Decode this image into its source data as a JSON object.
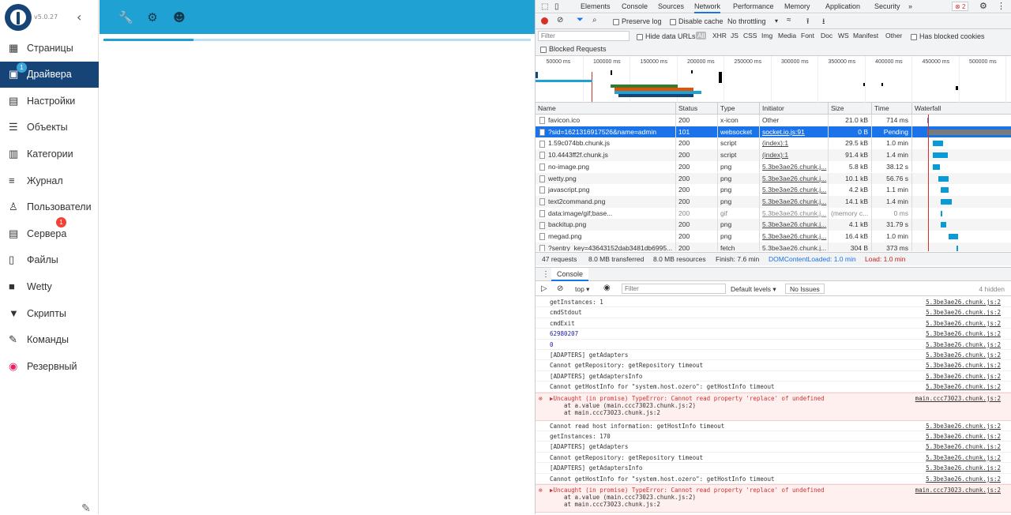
{
  "app": {
    "version": "v5.0.27",
    "collapse_icon": "chevron-left-icon",
    "sidebar": [
      {
        "label": "Страницы",
        "icon": "grid-icon",
        "active": false
      },
      {
        "label": "Драйвера",
        "icon": "driver-icon",
        "active": true,
        "badge": "1"
      },
      {
        "label": "Настройки",
        "icon": "settings-icon",
        "active": false
      },
      {
        "label": "Объекты",
        "icon": "list-icon",
        "active": false
      },
      {
        "label": "Категории",
        "icon": "category-icon",
        "active": false
      },
      {
        "label": "Журнал",
        "icon": "log-icon",
        "active": false
      },
      {
        "label": "Пользователи",
        "icon": "user-icon",
        "active": false
      },
      {
        "label": "Сервера",
        "icon": "server-icon",
        "active": false,
        "badge": "1"
      },
      {
        "label": "Файлы",
        "icon": "files-icon",
        "active": false
      },
      {
        "label": "Wetty",
        "icon": "terminal-icon",
        "active": false
      },
      {
        "label": "Скрипты",
        "icon": "script-icon",
        "active": false
      },
      {
        "label": "Команды",
        "icon": "commands-icon",
        "active": false
      },
      {
        "label": "Резервный",
        "icon": "backup-icon",
        "active": false
      }
    ],
    "topbar_icons": [
      "wrench-icon",
      "bug-icon",
      "head-icon"
    ],
    "accent": "#1fa2d3",
    "sidebar_active": "#164477",
    "progress": 0.21
  },
  "devtools": {
    "tabs": [
      "Elements",
      "Console",
      "Sources",
      "Network",
      "Performance",
      "Memory",
      "Application",
      "Security",
      "»"
    ],
    "active_tab": "Network",
    "error_count": "2",
    "toolbar": {
      "preserve_log": "Preserve log",
      "disable_cache": "Disable cache",
      "throttling": "No throttling"
    },
    "filter": {
      "placeholder": "Filter",
      "hide_data_urls": "Hide data URLs",
      "types": [
        "All",
        "XHR",
        "JS",
        "CSS",
        "Img",
        "Media",
        "Font",
        "Doc",
        "WS",
        "Manifest",
        "Other"
      ],
      "has_blocked": "Has blocked cookies",
      "blocked_requests": "Blocked Requests"
    },
    "overview_ticks": [
      "50000 ms",
      "100000 ms",
      "150000 ms",
      "200000 ms",
      "250000 ms",
      "300000 ms",
      "350000 ms",
      "400000 ms",
      "450000 ms",
      "500000 ms"
    ],
    "columns": [
      "Name",
      "Status",
      "Type",
      "Initiator",
      "Size",
      "Time",
      "Waterfall"
    ],
    "rows": [
      {
        "name": "favicon.ico",
        "status": "200",
        "type": "x-icon",
        "initiator": "Other",
        "size": "21.0 kB",
        "time": "714 ms",
        "wf": 0.03,
        "ww": 0.02,
        "link": false
      },
      {
        "name": "?sid=1621316917526&name=admin",
        "status": "101",
        "type": "websocket",
        "initiator": "socket.io.js:91",
        "size": "0 B",
        "time": "Pending",
        "wf": 0.03,
        "ww": 0.97,
        "link": true,
        "sel": true
      },
      {
        "name": "1.59c074bb.chunk.js",
        "status": "200",
        "type": "script",
        "initiator": "(index):1",
        "size": "29.5 kB",
        "time": "1.0 min",
        "wf": 0.1,
        "ww": 0.13,
        "link": true
      },
      {
        "name": "10.4443ff2f.chunk.js",
        "status": "200",
        "type": "script",
        "initiator": "(index):1",
        "size": "91.4 kB",
        "time": "1.4 min",
        "wf": 0.1,
        "ww": 0.19,
        "link": true
      },
      {
        "name": "no-image.png",
        "status": "200",
        "type": "png",
        "initiator": "5.3be3ae26.chunk.j...",
        "size": "5.8 kB",
        "time": "38.12 s",
        "wf": 0.1,
        "ww": 0.09,
        "link": true
      },
      {
        "name": "wetty.png",
        "status": "200",
        "type": "png",
        "initiator": "5.3be3ae26.chunk.j...",
        "size": "10.1 kB",
        "time": "56.76 s",
        "wf": 0.17,
        "ww": 0.13,
        "link": true
      },
      {
        "name": "javascript.png",
        "status": "200",
        "type": "png",
        "initiator": "5.3be3ae26.chunk.j...",
        "size": "4.2 kB",
        "time": "1.1 min",
        "wf": 0.2,
        "ww": 0.1,
        "link": true
      },
      {
        "name": "text2command.png",
        "status": "200",
        "type": "png",
        "initiator": "5.3be3ae26.chunk.j...",
        "size": "14.1 kB",
        "time": "1.4 min",
        "wf": 0.2,
        "ww": 0.14,
        "link": true
      },
      {
        "name": "data:image/gif;base...",
        "status": "200",
        "type": "gif",
        "initiator": "5.3be3ae26.chunk.j...",
        "size": "(memory c...",
        "time": "0 ms",
        "wf": 0.2,
        "ww": 0.01,
        "link": true,
        "dim": true
      },
      {
        "name": "backitup.png",
        "status": "200",
        "type": "png",
        "initiator": "5.3be3ae26.chunk.j...",
        "size": "4.1 kB",
        "time": "31.79 s",
        "wf": 0.2,
        "ww": 0.07,
        "link": true
      },
      {
        "name": "megad.png",
        "status": "200",
        "type": "png",
        "initiator": "5.3be3ae26.chunk.j...",
        "size": "16.4 kB",
        "time": "1.0 min",
        "wf": 0.3,
        "ww": 0.12,
        "link": true
      },
      {
        "name": "?sentry_key=43643152dab3481db6995...",
        "status": "200",
        "type": "fetch",
        "initiator": "5.3be3ae26.chunk.j...",
        "size": "304 B",
        "time": "373 ms",
        "wf": 0.4,
        "ww": 0.02,
        "link": true
      }
    ],
    "summary": {
      "requests": "47 requests",
      "transferred": "8.0 MB transferred",
      "resources": "8.0 MB resources",
      "finish": "Finish: 7.6 min",
      "dcl": "DOMContentLoaded: 1.0 min",
      "load": "Load: 1.0 min"
    },
    "drawer_tab": "Console",
    "console_toolbar": {
      "context": "top ▾",
      "filter": "Filter",
      "levels": "Default levels ▾",
      "issues": "No Issues",
      "hidden": "4 hidden"
    },
    "console": [
      {
        "msg": "getInstances: 1",
        "src": "5.3be3ae26.chunk.js:2"
      },
      {
        "msg": "cmdStdout",
        "src": "5.3be3ae26.chunk.js:2"
      },
      {
        "msg": "cmdExit",
        "src": "5.3be3ae26.chunk.js:2"
      },
      {
        "msg": "62980207",
        "src": "5.3be3ae26.chunk.js:2",
        "num": true
      },
      {
        "msg": "0",
        "src": "5.3be3ae26.chunk.js:2",
        "num": true
      },
      {
        "msg": "[ADAPTERS] getAdapters",
        "src": "5.3be3ae26.chunk.js:2"
      },
      {
        "msg": "Cannot getRepository: getRepository timeout",
        "src": "5.3be3ae26.chunk.js:2"
      },
      {
        "msg": "[ADAPTERS] getAdaptersInfo",
        "src": "5.3be3ae26.chunk.js:2"
      },
      {
        "msg": "Cannot getHostInfo for \"system.host.ozero\": getHostInfo timeout",
        "src": "5.3be3ae26.chunk.js:2"
      },
      {
        "msg": "▶Uncaught (in promise) TypeError: Cannot read property 'replace' of undefined",
        "src": "main.ccc73023.chunk.js:2",
        "err": true,
        "sub1": "at a.value (main.ccc73023.chunk.js:2)",
        "sub2": "at main.ccc73023.chunk.js:2"
      },
      {
        "msg": "Cannot read host information: getHostInfo timeout",
        "src": "5.3be3ae26.chunk.js:2"
      },
      {
        "msg": "getInstances: 170",
        "src": "5.3be3ae26.chunk.js:2"
      },
      {
        "msg": "[ADAPTERS] getAdapters",
        "src": "5.3be3ae26.chunk.js:2"
      },
      {
        "msg": "Cannot getRepository: getRepository timeout",
        "src": "5.3be3ae26.chunk.js:2"
      },
      {
        "msg": "[ADAPTERS] getAdaptersInfo",
        "src": "5.3be3ae26.chunk.js:2"
      },
      {
        "msg": "Cannot getHostInfo for \"system.host.ozero\": getHostInfo timeout",
        "src": "5.3be3ae26.chunk.js:2"
      },
      {
        "msg": "▶Uncaught (in promise) TypeError: Cannot read property 'replace' of undefined",
        "src": "main.ccc73023.chunk.js:2",
        "err": true,
        "sub1": "at a.value (main.ccc73023.chunk.js:2)",
        "sub2": "at main.ccc73023.chunk.js:2"
      }
    ],
    "prompt": "›"
  }
}
